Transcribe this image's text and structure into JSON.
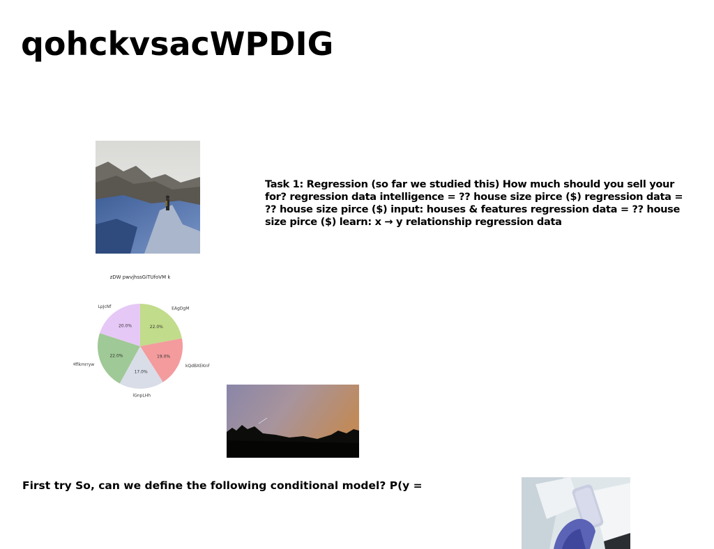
{
  "slide": {
    "title": "qohckvsacWPDIG",
    "task_text": "Task 1: Regression (so far we studied this) How much should you sell your for? regression data intelligence = ?? house size pirce ($) regression data = ?? house size pirce ($) input: houses & features regression data = ?? house size pirce ($) learn: x → y relationship regression data",
    "bottom_text": "First try So, can we define the following conditional model? P(y ="
  },
  "chart_data": {
    "type": "pie",
    "title": "zDW pwvjhssGiTUfoVM k",
    "slices": [
      {
        "label": "EAgDgM",
        "value": 22.0,
        "pct_label": "22.0%",
        "color": "#c1dc8a"
      },
      {
        "label": "kQdBXEKnF",
        "value": 19.0,
        "pct_label": "19.0%",
        "color": "#f39b9d"
      },
      {
        "label": "lGnpLHh",
        "value": 17.0,
        "pct_label": "17.0%",
        "color": "#d9dde8"
      },
      {
        "label": "Mfikmrryw",
        "value": 22.0,
        "pct_label": "22.0%",
        "color": "#9fc996"
      },
      {
        "label": "LpJcNf",
        "value": 20.0,
        "pct_label": "20.0%",
        "color": "#e6c8f6"
      }
    ],
    "start_angle_deg": 90,
    "direction": "clockwise"
  }
}
